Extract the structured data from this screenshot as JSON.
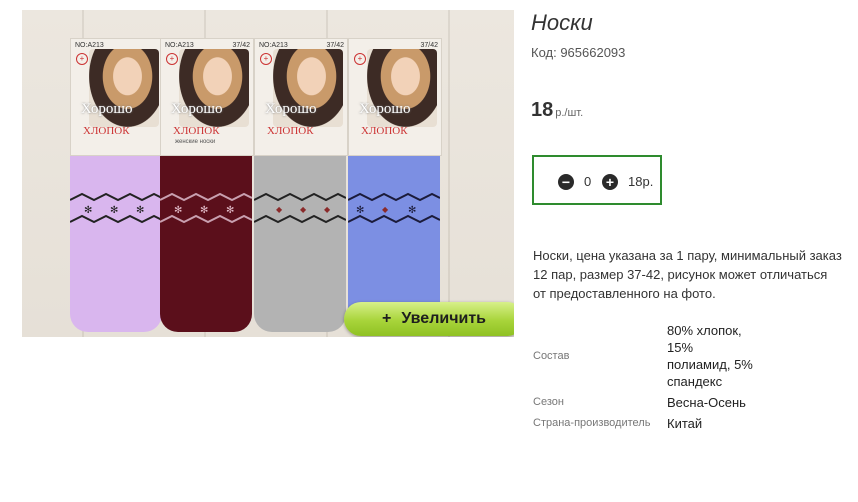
{
  "product": {
    "title": "Носки",
    "code": "Код: 965662093",
    "price": "18",
    "price_unit": "р./шт."
  },
  "quantity": {
    "value": "0",
    "sum": "18р."
  },
  "image": {
    "zoom_plus": "+",
    "zoom_label": "Увеличить",
    "card_code": "NO:A213",
    "card_size": "37/42",
    "card_brand": "Хорошо",
    "card_label": "ХЛОПОК",
    "card_sublabel": "женские носки"
  },
  "description": "Носки, цена указана за 1 пару, минимальный заказ 12 пар, размер 37-42, рисунок может отличаться от предоставленного на фото.",
  "properties": [
    {
      "key": "Состав",
      "value": "80% хлопок, 15% полиамид, 5% спандекс"
    },
    {
      "key": "Сезон",
      "value": "Весна-Осень"
    },
    {
      "key": "Страна-производитель",
      "value": "Китай"
    }
  ],
  "colors": {
    "accent_border": "#2e8b2e",
    "zoom_button": "#a8d43a",
    "sock_colors": [
      "#d9b6ee",
      "#5b0f1b",
      "#b3b3b3",
      "#7c8fe3"
    ]
  }
}
